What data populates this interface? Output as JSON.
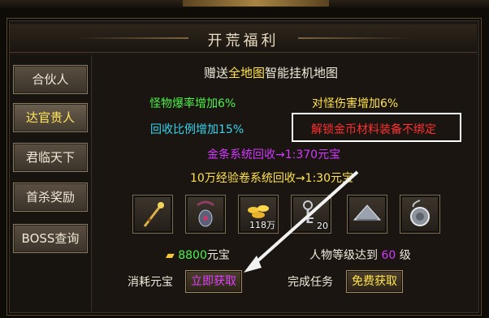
{
  "window": {
    "title": "开荒福利"
  },
  "sidebar": {
    "items": [
      {
        "label": "合伙人"
      },
      {
        "label": "达官贵人"
      },
      {
        "label": "君临天下"
      },
      {
        "label": "首杀奖励"
      },
      {
        "label": "BOSS查询"
      }
    ],
    "active_index": 1
  },
  "main": {
    "headline": {
      "prefix": "赠送",
      "highlight": "全地图",
      "suffix": "智能挂机地图"
    },
    "perks": {
      "drop_rate": "怪物爆率增加6%",
      "damage": "对怪伤害增加6%",
      "recycle": "回收比例增加15%",
      "unbind": "解锁金币材料装备不绑定"
    },
    "recycle_lines": {
      "gold_bar": "金条系统回收→1:370元宝",
      "exp_scroll": "10万经验卷系统回收→1:30元宝"
    },
    "items": [
      {
        "icon": "staff-icon",
        "count": ""
      },
      {
        "icon": "amulet-icon",
        "count": ""
      },
      {
        "icon": "gold-ingot-pile-icon",
        "count": "118万"
      },
      {
        "icon": "key-ring-icon",
        "count": "20"
      },
      {
        "icon": "bamboo-hat-icon",
        "count": ""
      },
      {
        "icon": "medal-icon",
        "count": ""
      }
    ],
    "cost": {
      "amount": "8800",
      "currency": "元宝",
      "label": "消耗元宝",
      "button": "立即获取"
    },
    "task": {
      "req_prefix": "人物等级达到",
      "level": "60",
      "req_suffix": "级",
      "label": "完成任务",
      "button": "免费获取"
    }
  },
  "colors": {
    "yellow": "#ffe34a",
    "green": "#4df24a",
    "cyan": "#35d4ee",
    "magenta": "#d238ff",
    "red": "#ff3030"
  }
}
